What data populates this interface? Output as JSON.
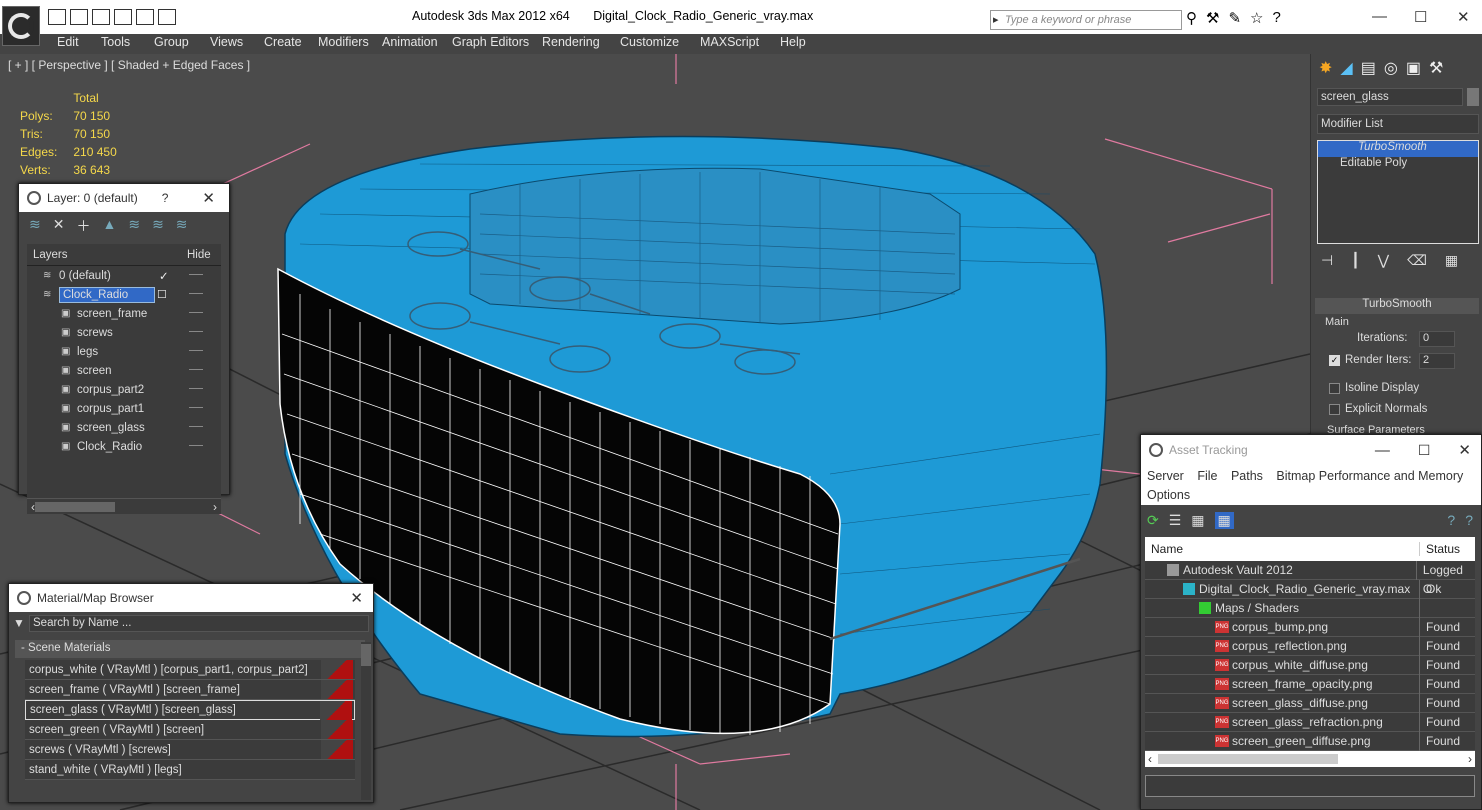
{
  "app": {
    "product": "Autodesk 3ds Max  2012 x64",
    "file": "Digital_Clock_Radio_Generic_vray.max",
    "search_placeholder": "Type a keyword or phrase"
  },
  "menu": [
    "Edit",
    "Tools",
    "Group",
    "Views",
    "Create",
    "Modifiers",
    "Animation",
    "Graph Editors",
    "Rendering",
    "Customize",
    "MAXScript",
    "Help"
  ],
  "viewport": {
    "label": "[ + ] [ Perspective ] [ Shaded + Edged Faces ]",
    "stats": {
      "header": "Total",
      "polys_label": "Polys:",
      "polys": "70 150",
      "tris_label": "Tris:",
      "tris": "70 150",
      "edges_label": "Edges:",
      "edges": "210 450",
      "verts_label": "Verts:",
      "verts": "36 643"
    }
  },
  "command_panel": {
    "object_name": "screen_glass",
    "modifier_list": "Modifier List",
    "stack": [
      "TurboSmooth",
      "Editable Poly"
    ],
    "rollout_title": "TurboSmooth",
    "main_label": "Main",
    "iterations_label": "Iterations:",
    "iterations": "0",
    "render_iters_label": "Render Iters:",
    "render_iters": "2",
    "isoline": "Isoline Display",
    "explicit": "Explicit Normals",
    "surface": "Surface Parameters"
  },
  "layer_panel": {
    "title": "Layer: 0 (default)",
    "help": "?",
    "col_layers": "Layers",
    "col_hide": "Hide",
    "rows": [
      {
        "name": "0 (default)",
        "indent": 1
      },
      {
        "name": "Clock_Radio",
        "indent": 1,
        "selected": true
      },
      {
        "name": "screen_frame",
        "indent": 2
      },
      {
        "name": "screws",
        "indent": 2
      },
      {
        "name": "legs",
        "indent": 2
      },
      {
        "name": "screen",
        "indent": 2
      },
      {
        "name": "corpus_part2",
        "indent": 2
      },
      {
        "name": "corpus_part1",
        "indent": 2
      },
      {
        "name": "screen_glass",
        "indent": 2
      },
      {
        "name": "Clock_Radio",
        "indent": 2
      }
    ]
  },
  "material_browser": {
    "title": "Material/Map Browser",
    "search_placeholder": "Search by Name ...",
    "group": "- Scene Materials",
    "items": [
      "corpus_white  ( VRayMtl ) [corpus_part1, corpus_part2]",
      "screen_frame  ( VRayMtl ) [screen_frame]",
      "screen_glass  ( VRayMtl ) [screen_glass]",
      "screen_green  ( VRayMtl ) [screen]",
      "screws  ( VRayMtl ) [screws]",
      "stand_white  ( VRayMtl ) [legs]"
    ]
  },
  "asset_tracking": {
    "title": "Asset Tracking",
    "menu": [
      "Server",
      "File",
      "Paths",
      "Bitmap Performance and Memory",
      "Options"
    ],
    "col_name": "Name",
    "col_status": "Status",
    "rows": [
      {
        "name": "Autodesk Vault 2012",
        "status": "Logged O",
        "indent": 0,
        "icon": "vault"
      },
      {
        "name": "Digital_Clock_Radio_Generic_vray.max",
        "status": "Ok",
        "indent": 1,
        "icon": "max"
      },
      {
        "name": "Maps / Shaders",
        "status": "",
        "indent": 2,
        "icon": "maps"
      },
      {
        "name": "corpus_bump.png",
        "status": "Found",
        "indent": 3,
        "icon": "png"
      },
      {
        "name": "corpus_reflection.png",
        "status": "Found",
        "indent": 3,
        "icon": "png"
      },
      {
        "name": "corpus_white_diffuse.png",
        "status": "Found",
        "indent": 3,
        "icon": "png"
      },
      {
        "name": "screen_frame_opacity.png",
        "status": "Found",
        "indent": 3,
        "icon": "png"
      },
      {
        "name": "screen_glass_diffuse.png",
        "status": "Found",
        "indent": 3,
        "icon": "png"
      },
      {
        "name": "screen_glass_refraction.png",
        "status": "Found",
        "indent": 3,
        "icon": "png"
      },
      {
        "name": "screen_green_diffuse.png",
        "status": "Found",
        "indent": 3,
        "icon": "png"
      }
    ]
  },
  "colors": {
    "model": "#1e9ad6",
    "wire": "#0a3d5c",
    "screen": "#050505",
    "selection": "#3169c6"
  }
}
